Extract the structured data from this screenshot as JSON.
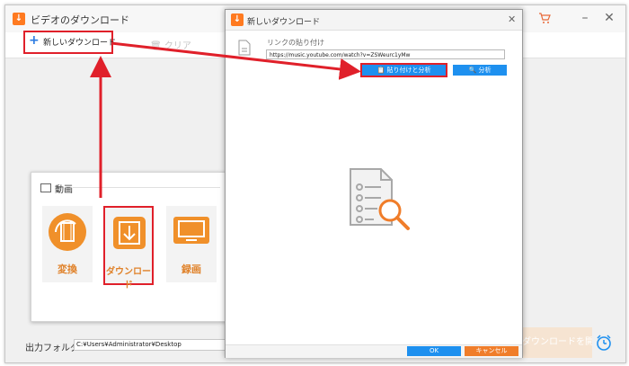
{
  "main_window": {
    "title": "ビデオのダウンロード",
    "app_icon": "download-arrow",
    "toolbar": {
      "new_download_label": "新しいダウンロード",
      "clear_label": "クリア"
    }
  },
  "start_panel": {
    "section_label": "動画",
    "tiles": [
      {
        "label": "変換",
        "icon": "film-convert-icon"
      },
      {
        "label": "ダウンロード",
        "icon": "download-arrow-icon"
      },
      {
        "label": "録画",
        "icon": "screen-record-icon"
      }
    ]
  },
  "bottom_bar": {
    "output_folder_label": "出力フォルダ：",
    "output_folder_value": "C:¥Users¥Administrator¥Desktop",
    "start_button_label": "ダウンロードを開始"
  },
  "dialog": {
    "title": "新しいダウンロード",
    "link_paste_label": "リンクの貼り付け",
    "url_value": "https://music.youtube.com/watch?v=ZSWeurc1yMw",
    "paste_analyze_label": "貼り付けと分析",
    "analyze_label": "分析",
    "ok_label": "OK",
    "cancel_label": "キャンセル"
  },
  "colors": {
    "accent_orange": "#f0902a",
    "blue": "#1e90ef",
    "highlight_red": "#e0202a"
  }
}
